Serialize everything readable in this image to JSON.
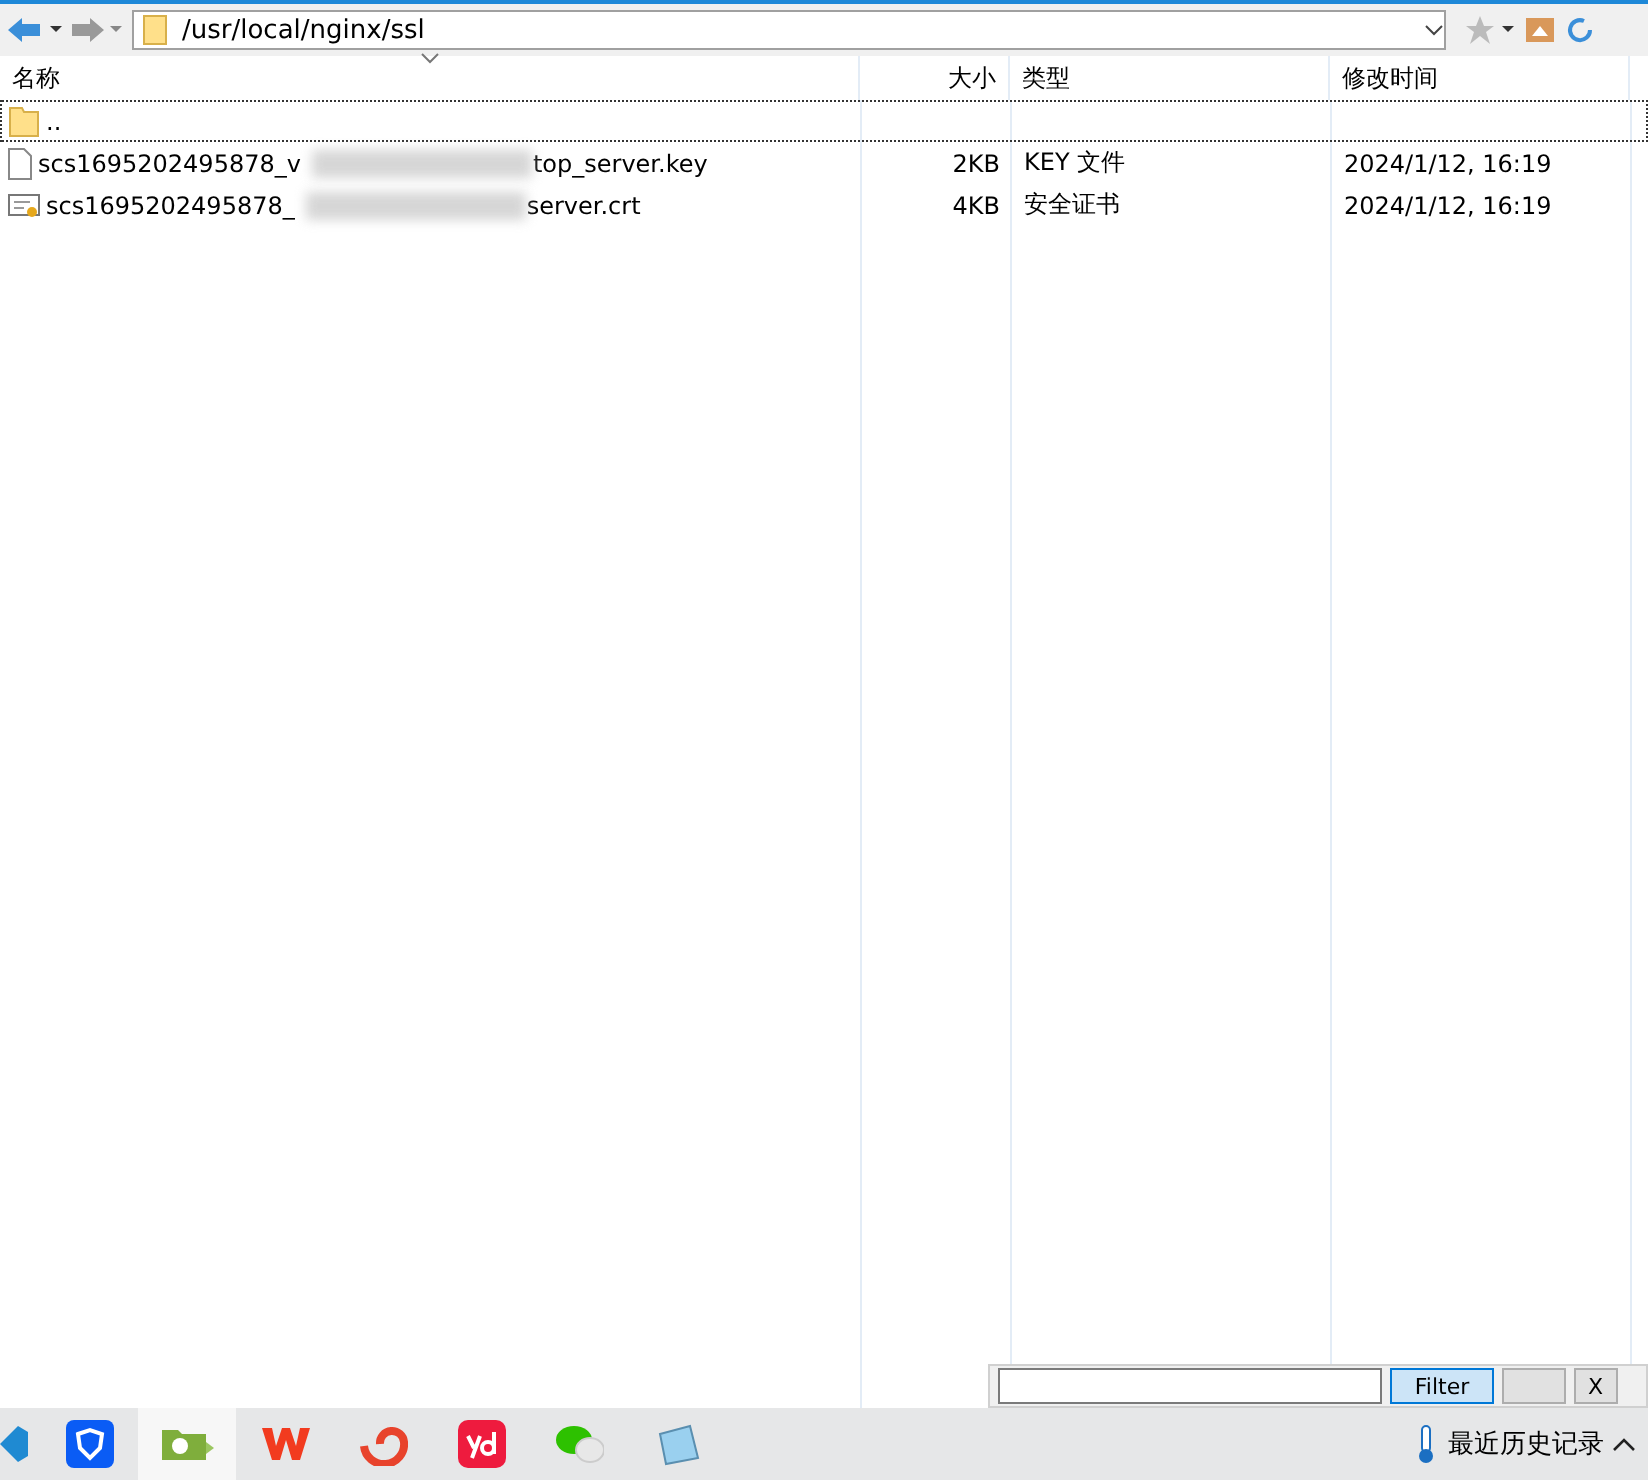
{
  "toolbar": {
    "path": "/usr/local/nginx/ssl"
  },
  "columns": [
    {
      "label": "名称",
      "sorted": true
    },
    {
      "label": "大小",
      "sorted": false
    },
    {
      "label": "类型",
      "sorted": false
    },
    {
      "label": "修改时间",
      "sorted": false
    }
  ],
  "files": [
    {
      "kind": "parent",
      "name_start": "..",
      "focused": true
    },
    {
      "kind": "key",
      "name_start": "scs1695202495878_v",
      "name_end": "top_server.key",
      "size": "2KB",
      "type": "KEY 文件",
      "modified": "2024/1/12, 16:19",
      "focused": false
    },
    {
      "kind": "cert",
      "name_start": "scs1695202495878_",
      "name_end": "server.crt",
      "size": "4KB",
      "type": "安全证书",
      "modified": "2024/1/12, 16:19",
      "focused": false
    }
  ],
  "filter": {
    "button": "Filter",
    "close": "X"
  },
  "taskbar": {
    "apps": [
      {
        "kind": "vscode",
        "selected": false
      },
      {
        "kind": "shield",
        "selected": false
      },
      {
        "kind": "folder-app",
        "selected": true
      },
      {
        "kind": "wps",
        "selected": false
      },
      {
        "kind": "swirl",
        "selected": false
      },
      {
        "kind": "yd",
        "selected": false
      },
      {
        "kind": "chat",
        "selected": false
      },
      {
        "kind": "notepad",
        "selected": false
      }
    ],
    "tray_text": "最近历史记录"
  }
}
